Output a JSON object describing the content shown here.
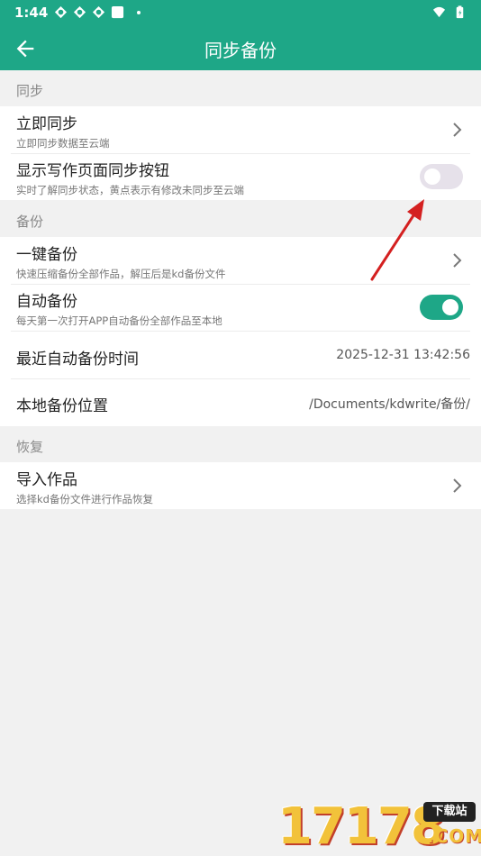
{
  "status_bar": {
    "time": "1:44"
  },
  "app_bar": {
    "title": "同步备份"
  },
  "sections": {
    "sync": {
      "header": "同步",
      "sync_now": {
        "label": "立即同步",
        "sub": "立即同步数据至云端"
      },
      "show_sync_button": {
        "label": "显示写作页面同步按钮",
        "sub": "实时了解同步状态，黄点表示有修改未同步至云端",
        "enabled": false
      }
    },
    "backup": {
      "header": "备份",
      "one_click": {
        "label": "一键备份",
        "sub": "快速压缩备份全部作品，解压后是kd备份文件"
      },
      "auto_backup": {
        "label": "自动备份",
        "sub": "每天第一次打开APP自动备份全部作品至本地",
        "enabled": true
      },
      "last_time": {
        "label": "最近自动备份时间",
        "value": "2025-12-31 13:42:56"
      },
      "location": {
        "label": "本地备份位置",
        "value": "/Documents/kdwrite/备份/"
      }
    },
    "restore": {
      "header": "恢复",
      "import": {
        "label": "导入作品",
        "sub": "选择kd备份文件进行作品恢复"
      }
    }
  },
  "watermark": {
    "number": "17178",
    "badge": "下载站",
    "suffix": ".COM"
  },
  "colors": {
    "primary": "#1ea787",
    "annotation_arrow": "#d42020"
  }
}
